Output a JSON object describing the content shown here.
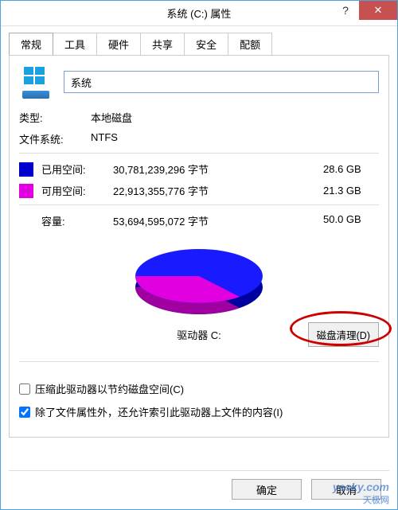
{
  "titlebar": {
    "title": "系统 (C:) 属性",
    "close": "✕",
    "help": "?"
  },
  "tabs": [
    {
      "label": "常规"
    },
    {
      "label": "工具"
    },
    {
      "label": "硬件"
    },
    {
      "label": "共享"
    },
    {
      "label": "安全"
    },
    {
      "label": "配额"
    }
  ],
  "drive_name": "系统",
  "type_label": "类型:",
  "type_value": "本地磁盘",
  "fs_label": "文件系统:",
  "fs_value": "NTFS",
  "used_label": "已用空间:",
  "used_bytes": "30,781,239,296 字节",
  "used_gb": "28.6 GB",
  "free_label": "可用空间:",
  "free_bytes": "22,913,355,776 字节",
  "free_gb": "21.3 GB",
  "cap_label": "容量:",
  "cap_bytes": "53,694,595,072 字节",
  "cap_gb": "50.0 GB",
  "drive_caption": "驱动器 C:",
  "cleanup_button": "磁盘清理(D)",
  "compress_label": "压缩此驱动器以节约磁盘空间(C)",
  "index_label": "除了文件属性外，还允许索引此驱动器上文件的内容(I)",
  "compress_checked": false,
  "index_checked": true,
  "ok_button": "确定",
  "cancel_button": "取消",
  "watermark": "yesky.com",
  "watermark_cn": "天极网",
  "colors": {
    "used": "#0000cc",
    "free": "#e000e0"
  },
  "chart_data": {
    "type": "pie",
    "title": "驱动器 C:",
    "series": [
      {
        "name": "已用空间",
        "value": 28.6,
        "color": "#0000cc"
      },
      {
        "name": "可用空间",
        "value": 21.3,
        "color": "#e000e0"
      }
    ],
    "unit": "GB",
    "used_fraction": 0.573
  }
}
